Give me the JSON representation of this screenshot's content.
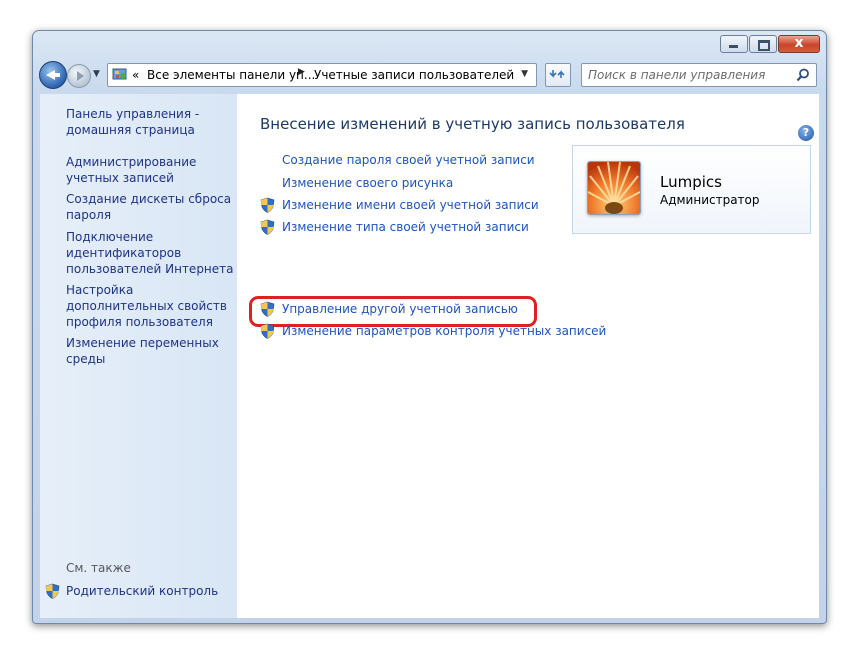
{
  "window": {
    "title_buttons": {
      "minimize": "minimize",
      "maximize": "maximize",
      "close": "x"
    }
  },
  "address_bar": {
    "overflow_marker": "«",
    "segments": [
      "Все элементы панели уп...",
      "Учетные записи пользователей"
    ],
    "separator": "▶",
    "dropdown": "▼"
  },
  "search": {
    "placeholder": "Поиск в панели управления"
  },
  "sidebar": {
    "links": [
      "Панель управления - домашняя страница",
      "Администрирование учетных записей",
      "Создание дискеты сброса пароля",
      "Подключение идентификаторов пользователей Интернета",
      "Настройка дополнительных свойств профиля пользователя",
      "Изменение переменных среды"
    ],
    "see_also_label": "См. также",
    "parental_control": "Родительский контроль"
  },
  "main": {
    "title": "Внесение изменений в учетную запись пользователя",
    "tasks": [
      {
        "label": "Создание пароля своей учетной записи",
        "shield": false
      },
      {
        "label": "Изменение своего рисунка",
        "shield": false
      },
      {
        "label": "Изменение имени своей учетной записи",
        "shield": true
      },
      {
        "label": "Изменение типа своей учетной записи",
        "shield": true
      },
      {
        "label": "Управление другой учетной записью",
        "shield": true,
        "highlighted": true
      },
      {
        "label": "Изменение параметров контроля учетных записей",
        "shield": true
      }
    ],
    "highlight_color": "#e02020",
    "user": {
      "name": "Lumpics",
      "role": "Администратор"
    }
  },
  "colors": {
    "link": "#1c54c0",
    "sidebar_link": "#1e3287",
    "sidebar_bg": "#dde9f6"
  },
  "icons": [
    "back-arrow-icon",
    "forward-arrow-icon",
    "control-panel-icon",
    "refresh-icon",
    "search-icon",
    "help-icon",
    "uac-shield-icon"
  ]
}
